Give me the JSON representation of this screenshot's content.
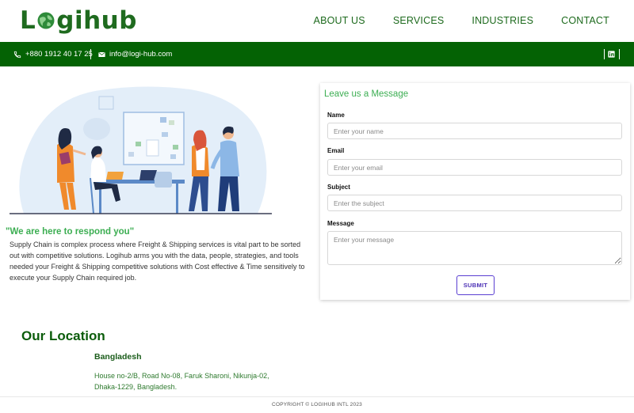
{
  "brand": {
    "logo_prefix": "L",
    "logo_suffix": "gihub",
    "logo_color": "#1f6b1f"
  },
  "nav": {
    "items": [
      "ABOUT US",
      "SERVICES",
      "INDUSTRIES",
      "CONTACT"
    ]
  },
  "topbar": {
    "phone": "+880 1912 40 17 25",
    "email": "info@logi-hub.com",
    "bg_color": "#046204",
    "social_icon": "linkedin-icon"
  },
  "intro": {
    "quote": "\"We are here to respond you\"",
    "description": "Supply Chain is complex process where Freight & Shipping services is vital part to be sorted out with competitive solutions. Logihub arms you with the data, people, strategies, and tools needed your Freight & Shipping competitive solutions with Cost effective & Time sensitively to execute your Supply Chain required job."
  },
  "form": {
    "title": "Leave us a Message",
    "name_label": "Name",
    "name_placeholder": "Enter your name",
    "email_label": "Email",
    "email_placeholder": "Enter your email",
    "subject_label": "Subject",
    "subject_placeholder": "Enter the subject",
    "message_label": "Message",
    "message_placeholder": "Enter your message",
    "submit_label": "SUBMIT"
  },
  "location": {
    "title": "Our Location",
    "country": "Bangladesh",
    "address": "House no-2/B, Road No-08, Faruk Sharoni, Nikunja-02, Dhaka-1229, Bangladesh."
  },
  "footer": {
    "copyright": "COPYRIGHT © LOGIHUB INTL 2023"
  },
  "colors": {
    "accent_green": "#3cae52",
    "dark_green": "#046204",
    "button_purple": "#4a2fb5"
  }
}
